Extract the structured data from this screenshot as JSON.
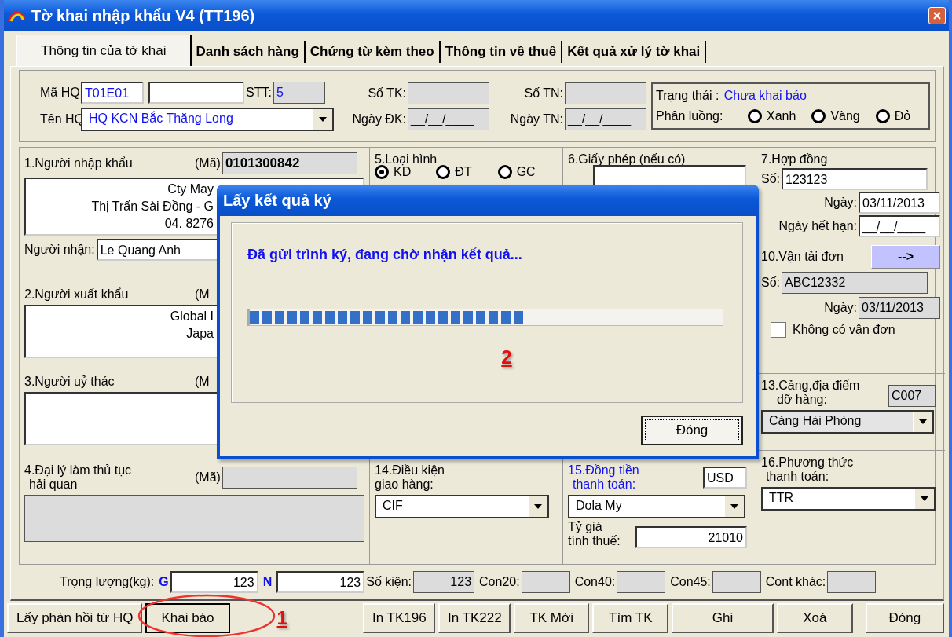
{
  "window": {
    "title": "Tờ khai nhập khẩu V4 (TT196)"
  },
  "tabs": [
    {
      "label": "Thông tin của tờ khai",
      "selected": true
    },
    {
      "label": "Danh sách hàng",
      "selected": false
    },
    {
      "label": "Chứng từ kèm theo",
      "selected": false
    },
    {
      "label": "Thông tin về thuế",
      "selected": false
    },
    {
      "label": "Kết quả xử lý tờ khai",
      "selected": false
    }
  ],
  "header": {
    "ma_hq_label": "Mã HQ",
    "ma_hq": "T01E01",
    "stt_label": "STT:",
    "stt": "5",
    "so_tk_label": "Số TK:",
    "so_tn_label": "Số TN:",
    "ten_hq_label": "Tên HQ",
    "ten_hq": "HQ KCN Bắc Thăng Long",
    "ngay_dk_label": "Ngày ĐK:",
    "ngay_dk": "__/__/____",
    "ngay_tn_label": "Ngày TN:",
    "ngay_tn": "__/__/____",
    "status_label": "Trạng thái :",
    "status": "Chưa khai báo",
    "lane_label": "Phân luồng:",
    "lanes": [
      {
        "label": "Xanh",
        "selected": false
      },
      {
        "label": "Vàng",
        "selected": false
      },
      {
        "label": "Đỏ",
        "selected": false
      }
    ]
  },
  "importer": {
    "title": "1.Người nhập khẩu",
    "code_label": "(Mã)",
    "code": "0101300842",
    "address_lines": [
      "Cty May",
      "Thị Trấn Sài Đồng - G",
      "04. 8276"
    ],
    "receiver_label": "Người nhận:",
    "receiver": "Le Quang Anh"
  },
  "exporter": {
    "title": "2.Người xuất khẩu",
    "code_label": "(M",
    "address_lines": [
      "Global I",
      "Japa"
    ]
  },
  "trustor": {
    "title": "3.Người uỷ thác",
    "code_label": "(M"
  },
  "agent": {
    "title": "4.Đại lý làm thủ tục",
    "subtitle": "hải quan",
    "code_label": "(Mã)"
  },
  "type": {
    "title": "5.Loại hình",
    "options": [
      {
        "label": "KD",
        "selected": true
      },
      {
        "label": "ĐT",
        "selected": false
      },
      {
        "label": "GC",
        "selected": false
      }
    ]
  },
  "license": {
    "title": "6.Giấy phép (nếu có)"
  },
  "contract": {
    "title": "7.Hợp đồng",
    "number_label": "Số:",
    "number": "123123",
    "date_label": "Ngày:",
    "date": "03/11/2013",
    "expiry_label": "Ngày hết hạn:",
    "expiry": "__/__/____"
  },
  "bill": {
    "title": "10.Vận tải đơn",
    "button": "-->",
    "number_label": "Số:",
    "number": "ABC12332",
    "date_label": "Ngày:",
    "date": "03/11/2013",
    "no_bill": {
      "label": "Không có vận đơn",
      "checked": false
    }
  },
  "port": {
    "title": "13.Cảng,địa điểm",
    "subtitle": "dỡ hàng:",
    "code": "C007",
    "name": "Cảng Hải Phòng"
  },
  "delivery": {
    "title": "14.Điều kiện",
    "subtitle": "giao hàng:",
    "value": "CIF"
  },
  "currency": {
    "title": "15.Đồng tiền",
    "subtitle": "thanh toán:",
    "code": "USD",
    "name": "Dola My",
    "rate_label": "Tỷ giá",
    "rate_sublabel": "tính thuế:",
    "rate": "21010"
  },
  "payment": {
    "title": "16.Phương thức",
    "subtitle": "thanh toán:",
    "value": "TTR"
  },
  "weight": {
    "label": "Trọng lượng(kg):",
    "gross_label": "G",
    "gross": "123",
    "net_label": "N",
    "net": "123",
    "packages_label": "Số kiện:",
    "packages": "123",
    "containers": [
      "Con20:",
      "Con40:",
      "Con45:",
      "Cont khác:"
    ]
  },
  "buttons_left": [
    "Lấy phản hồi từ HQ",
    "Khai báo"
  ],
  "buttons_right": [
    "In TK196",
    "In TK222",
    "TK Mới",
    "Tìm TK",
    "Ghi",
    "Xoá",
    "Đóng"
  ],
  "step_marks": [
    "1",
    "2"
  ],
  "dialog": {
    "title": "Lấy kết quả ký",
    "message": "Đã gửi trình ký, đang chờ nhận kết quả...",
    "level": 0.58,
    "button": "Đóng"
  }
}
